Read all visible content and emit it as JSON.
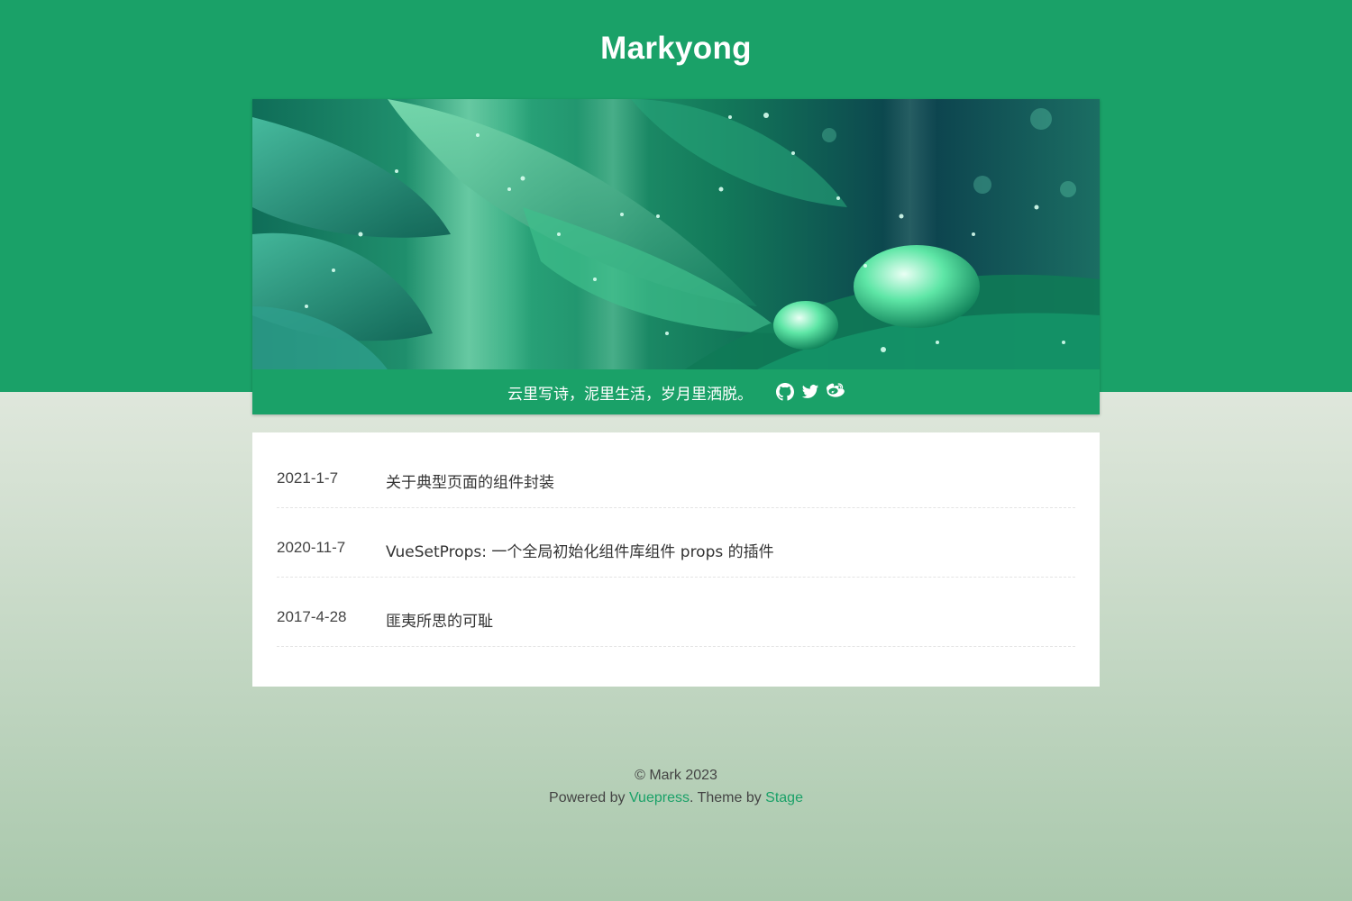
{
  "site": {
    "title": "Markyong",
    "tagline": "云里写诗，泥里生活，岁月里洒脱。"
  },
  "social_icons": [
    "github-icon",
    "twitter-icon",
    "weibo-icon"
  ],
  "posts": [
    {
      "date": "2021-1-7",
      "title": "关于典型页面的组件封装"
    },
    {
      "date": "2020-11-7",
      "title": "VueSetProps: 一个全局初始化组件库组件 props 的插件"
    },
    {
      "date": "2017-4-28",
      "title": "匪夷所思的可耻"
    }
  ],
  "footer": {
    "copyright": "© Mark 2023",
    "powered_prefix": "Powered by ",
    "powered_link": "Vuepress",
    "theme_prefix": ". Theme by ",
    "theme_link": "Stage"
  },
  "colors": {
    "brand": "#1aa168",
    "background_top": "#dfe7dc",
    "background_bottom": "#a9c8ac"
  }
}
